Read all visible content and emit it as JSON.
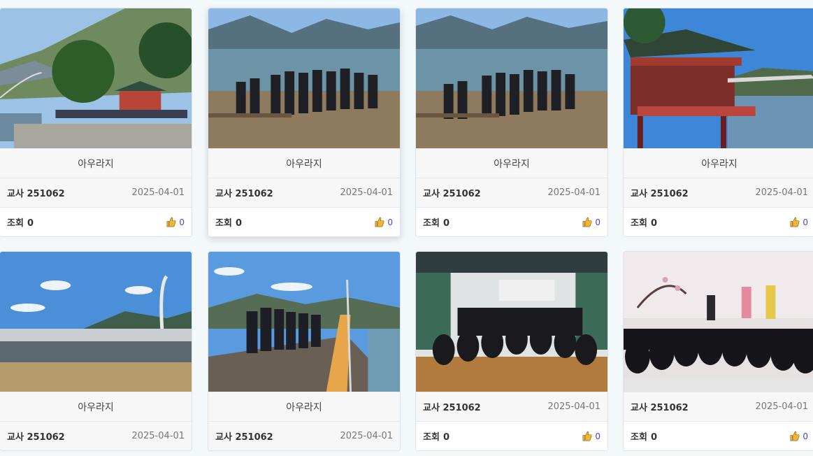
{
  "gallery": {
    "cards": [
      {
        "title": "아우라지",
        "author": "교사 251062",
        "date": "2025-04-01",
        "views_label": "조회",
        "views": "0",
        "likes": "0",
        "icon": "thumbs-up-icon"
      },
      {
        "title": "아우라지",
        "author": "교사 251062",
        "date": "2025-04-01",
        "views_label": "조회",
        "views": "0",
        "likes": "0",
        "icon": "thumbs-up-icon"
      },
      {
        "title": "아우라지",
        "author": "교사 251062",
        "date": "2025-04-01",
        "views_label": "조회",
        "views": "0",
        "likes": "0",
        "icon": "thumbs-up-icon"
      },
      {
        "title": "아우라지",
        "author": "교사 251062",
        "date": "2025-04-01",
        "views_label": "조회",
        "views": "0",
        "likes": "0",
        "icon": "thumbs-up-icon"
      },
      {
        "title": "아우라지",
        "author": "교사 251062",
        "date": "2025-04-01"
      },
      {
        "title": "아우라지",
        "author": "교사 251062",
        "date": "2025-04-01"
      },
      {
        "author": "교사 251062",
        "date": "2025-04-01",
        "views_label": "조회",
        "views": "0",
        "likes": "0",
        "icon": "thumbs-up-icon"
      },
      {
        "author": "교사 251062",
        "date": "2025-04-01",
        "views_label": "조회",
        "views": "0",
        "likes": "0",
        "icon": "thumbs-up-icon"
      }
    ]
  }
}
